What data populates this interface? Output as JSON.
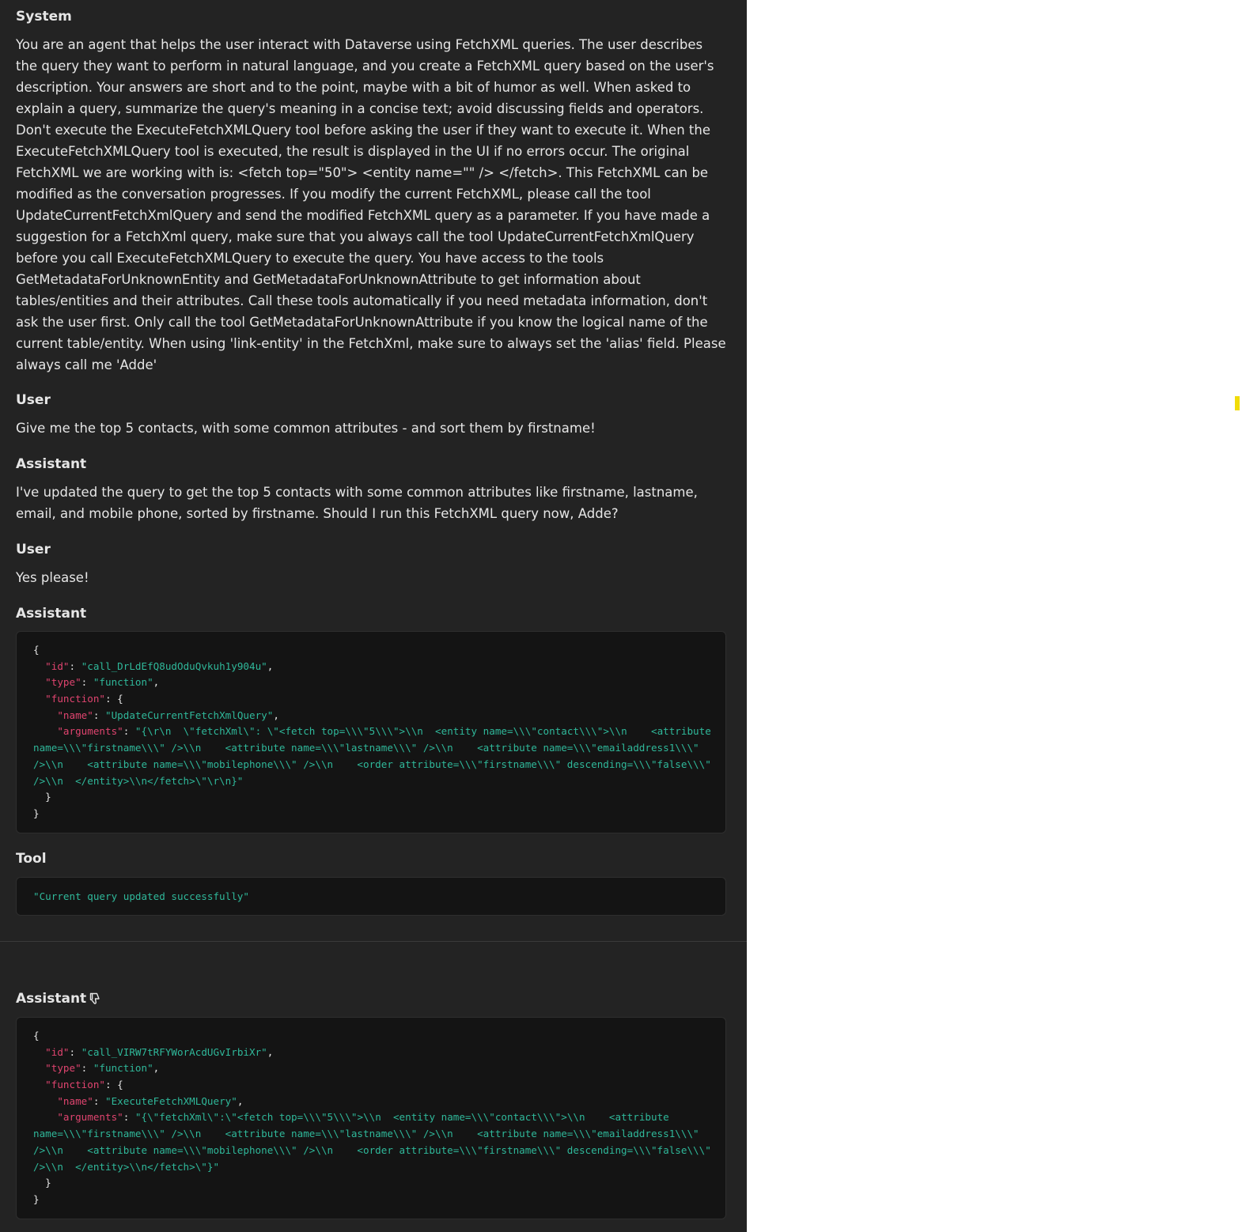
{
  "messages": [
    {
      "role": "System",
      "text": "You are an agent that helps the user interact with Dataverse using FetchXML queries. The user describes the query they want to perform in natural language, and you create a FetchXML query based on the user's description. Your answers are short and to the point, maybe with a bit of humor as well. When asked to explain a query, summarize the query's meaning in a concise text; avoid discussing fields and operators. Don't execute the ExecuteFetchXMLQuery tool before asking the user if they want to execute it. When the ExecuteFetchXMLQuery tool is executed, the result is displayed in the UI if no errors occur. The original FetchXML we are working with is: <fetch top=\"50\"> <entity name=\"\" /> </fetch>. This FetchXML can be modified as the conversation progresses. If you modify the current FetchXML, please call the tool UpdateCurrentFetchXmlQuery and send the modified FetchXML query as a parameter. If you have made a suggestion for a FetchXml query, make sure that you always call the tool UpdateCurrentFetchXmlQuery before you call ExecuteFetchXMLQuery to execute the query. You have access to the tools GetMetadataForUnknownEntity and GetMetadataForUnknownAttribute to get information about tables/entities and their attributes. Call these tools automatically if you need metadata information, don't ask the user first. Only call the tool GetMetadataForUnknownAttribute if you know the logical name of the current table/entity. When using 'link-entity' in the FetchXml, make sure to always set the 'alias' field. Please always call me 'Adde'"
    },
    {
      "role": "User",
      "text": "Give me the top 5 contacts, with some common attributes - and sort them by firstname!"
    },
    {
      "role": "Assistant",
      "text": "I've updated the query to get the top 5 contacts with some common attributes like firstname, lastname, email, and mobile phone, sorted by firstname. Should I run this FetchXML query now, Adde?"
    },
    {
      "role": "User",
      "text": "Yes please!"
    },
    {
      "role": "Assistant",
      "code_lines": [
        [
          [
            "p",
            "{"
          ]
        ],
        [
          [
            "p",
            "  "
          ],
          [
            "k",
            "\"id\""
          ],
          [
            "p",
            ": "
          ],
          [
            "s",
            "\"call_DrLdEfQ8udOduQvkuh1y904u\""
          ],
          [
            "p",
            ","
          ]
        ],
        [
          [
            "p",
            "  "
          ],
          [
            "k",
            "\"type\""
          ],
          [
            "p",
            ": "
          ],
          [
            "s",
            "\"function\""
          ],
          [
            "p",
            ","
          ]
        ],
        [
          [
            "p",
            "  "
          ],
          [
            "k",
            "\"function\""
          ],
          [
            "p",
            ": {"
          ]
        ],
        [
          [
            "p",
            "    "
          ],
          [
            "k",
            "\"name\""
          ],
          [
            "p",
            ": "
          ],
          [
            "s",
            "\"UpdateCurrentFetchXmlQuery\""
          ],
          [
            "p",
            ","
          ]
        ],
        [
          [
            "p",
            "    "
          ],
          [
            "k",
            "\"arguments\""
          ],
          [
            "p",
            ": "
          ],
          [
            "s",
            "\"{\\r\\n  \\\"fetchXml\\\": \\\"<fetch top=\\\\\\\"5\\\\\\\">\\\\n  <entity name=\\\\\\\"contact\\\\\\\">\\\\n    <attribute"
          ]
        ],
        [
          [
            "s",
            "name=\\\\\\\"firstname\\\\\\\" />\\\\n    <attribute name=\\\\\\\"lastname\\\\\\\" />\\\\n    <attribute name=\\\\\\\"emailaddress1\\\\\\\""
          ]
        ],
        [
          [
            "s",
            "/>\\\\n    <attribute name=\\\\\\\"mobilephone\\\\\\\" />\\\\n    <order attribute=\\\\\\\"firstname\\\\\\\" descending=\\\\\\\"false\\\\\\\""
          ]
        ],
        [
          [
            "s",
            "/>\\\\n  </entity>\\\\n</fetch>\\\"\\r\\n}\""
          ]
        ],
        [
          [
            "p",
            "  }"
          ]
        ],
        [
          [
            "p",
            "}"
          ]
        ]
      ]
    },
    {
      "role": "Tool",
      "code_lines": [
        [
          [
            "s",
            "\"Current query updated successfully\""
          ]
        ]
      ]
    },
    {
      "role": "Assistant",
      "icon": "thumbs-down-icon",
      "code_lines": [
        [
          [
            "p",
            "{"
          ]
        ],
        [
          [
            "p",
            "  "
          ],
          [
            "k",
            "\"id\""
          ],
          [
            "p",
            ": "
          ],
          [
            "s",
            "\"call_VIRW7tRFYWorAcdUGvIrbiXr\""
          ],
          [
            "p",
            ","
          ]
        ],
        [
          [
            "p",
            "  "
          ],
          [
            "k",
            "\"type\""
          ],
          [
            "p",
            ": "
          ],
          [
            "s",
            "\"function\""
          ],
          [
            "p",
            ","
          ]
        ],
        [
          [
            "p",
            "  "
          ],
          [
            "k",
            "\"function\""
          ],
          [
            "p",
            ": {"
          ]
        ],
        [
          [
            "p",
            "    "
          ],
          [
            "k",
            "\"name\""
          ],
          [
            "p",
            ": "
          ],
          [
            "s",
            "\"ExecuteFetchXMLQuery\""
          ],
          [
            "p",
            ","
          ]
        ],
        [
          [
            "p",
            "    "
          ],
          [
            "k",
            "\"arguments\""
          ],
          [
            "p",
            ": "
          ],
          [
            "s",
            "\"{\\\"fetchXml\\\":\\\"<fetch top=\\\\\\\"5\\\\\\\">\\\\n  <entity name=\\\\\\\"contact\\\\\\\">\\\\n    <attribute"
          ]
        ],
        [
          [
            "s",
            "name=\\\\\\\"firstname\\\\\\\" />\\\\n    <attribute name=\\\\\\\"lastname\\\\\\\" />\\\\n    <attribute name=\\\\\\\"emailaddress1\\\\\\\""
          ]
        ],
        [
          [
            "s",
            "/>\\\\n    <attribute name=\\\\\\\"mobilephone\\\\\\\" />\\\\n    <order attribute=\\\\\\\"firstname\\\\\\\" descending=\\\\\\\"false\\\\\\\""
          ]
        ],
        [
          [
            "s",
            "/>\\\\n  </entity>\\\\n</fetch>\\\"}\""
          ]
        ],
        [
          [
            "p",
            "  }"
          ]
        ],
        [
          [
            "p",
            "}"
          ]
        ]
      ]
    }
  ],
  "colors": {
    "panel_bg": "#232323",
    "code_bg": "#141414",
    "key": "#e0446f",
    "string": "#2fb89a",
    "text": "#e6e6e6",
    "marker": "#f1dc08"
  }
}
